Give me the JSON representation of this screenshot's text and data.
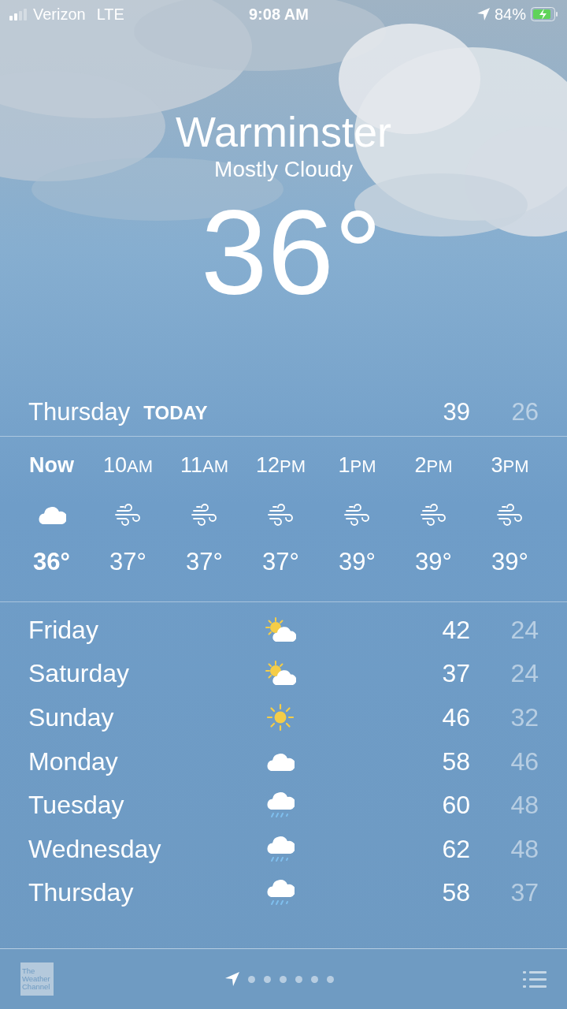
{
  "status_bar": {
    "carrier": "Verizon",
    "network": "LTE",
    "time": "9:08 AM",
    "battery": "84%"
  },
  "location": {
    "city": "Warminster",
    "condition": "Mostly Cloudy",
    "temperature": "36°"
  },
  "today": {
    "day": "Thursday",
    "label": "TODAY",
    "high": "39",
    "low": "26"
  },
  "hourly": [
    {
      "hour": "Now",
      "selected": true,
      "kind": "cloud",
      "temp": "36°"
    },
    {
      "hour": "10",
      "period": "AM",
      "selected": false,
      "kind": "wind",
      "temp": "37°"
    },
    {
      "hour": "11",
      "period": "AM",
      "selected": false,
      "kind": "wind",
      "temp": "37°"
    },
    {
      "hour": "12",
      "period": "PM",
      "selected": false,
      "kind": "wind",
      "temp": "37°"
    },
    {
      "hour": "1",
      "period": "PM",
      "selected": false,
      "kind": "wind",
      "temp": "39°"
    },
    {
      "hour": "2",
      "period": "PM",
      "selected": false,
      "kind": "wind",
      "temp": "39°"
    },
    {
      "hour": "3",
      "period": "PM",
      "selected": false,
      "kind": "wind",
      "temp": "39°"
    }
  ],
  "daily": [
    {
      "day": "Friday",
      "kind": "partly-sunny",
      "high": "42",
      "low": "24"
    },
    {
      "day": "Saturday",
      "kind": "partly-sunny",
      "high": "37",
      "low": "24"
    },
    {
      "day": "Sunday",
      "kind": "sunny",
      "high": "46",
      "low": "32"
    },
    {
      "day": "Monday",
      "kind": "cloud",
      "high": "58",
      "low": "46"
    },
    {
      "day": "Tuesday",
      "kind": "rain",
      "high": "60",
      "low": "48"
    },
    {
      "day": "Wednesday",
      "kind": "rain",
      "high": "62",
      "low": "48"
    },
    {
      "day": "Thursday",
      "kind": "rain",
      "high": "58",
      "low": "37"
    }
  ],
  "bottom_bar": {
    "logo": [
      "The",
      "Weather",
      "Channel"
    ],
    "pages": [
      {
        "kind": "location",
        "selected": true
      },
      {
        "kind": "dot",
        "selected": false
      },
      {
        "kind": "dot",
        "selected": false
      },
      {
        "kind": "dot",
        "selected": false
      },
      {
        "kind": "dot",
        "selected": false
      },
      {
        "kind": "dot",
        "selected": false
      },
      {
        "kind": "dot",
        "selected": false
      }
    ]
  }
}
